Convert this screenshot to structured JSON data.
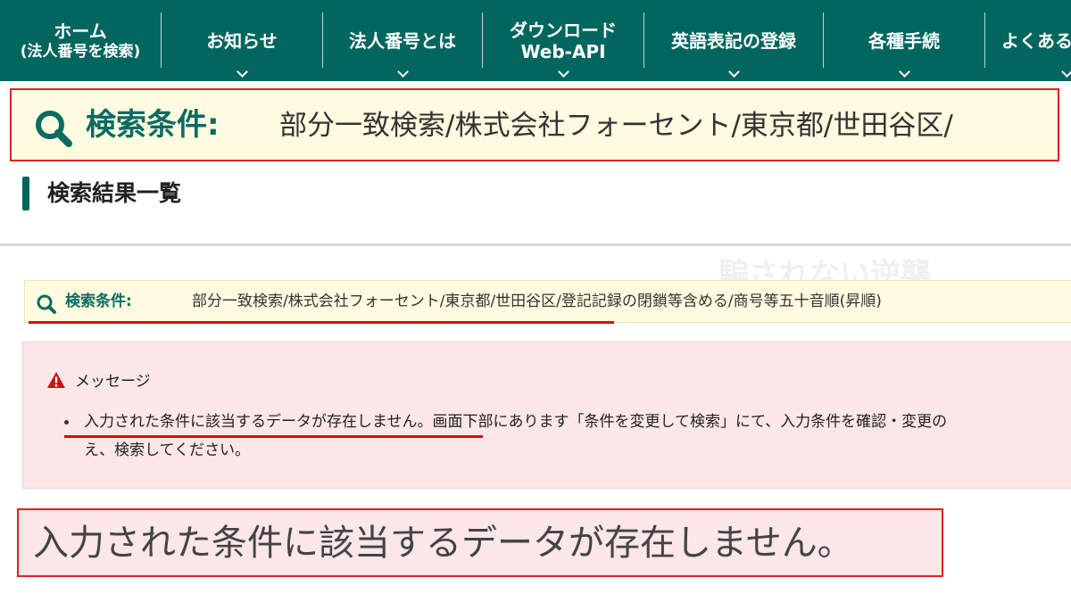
{
  "nav": {
    "items": [
      {
        "line1": "ホーム",
        "line2": "(法人番号を検索)",
        "has_dropdown": false
      },
      {
        "line1": "お知らせ",
        "line2": "",
        "has_dropdown": true
      },
      {
        "line1": "法人番号とは",
        "line2": "",
        "has_dropdown": true
      },
      {
        "line1": "ダウンロード",
        "line2": "Web-API",
        "has_dropdown": true
      },
      {
        "line1": "英語表記の登録",
        "line2": "",
        "has_dropdown": true
      },
      {
        "line1": "各種手続",
        "line2": "",
        "has_dropdown": true
      },
      {
        "line1": "よくある",
        "line2": "",
        "has_dropdown": true
      }
    ]
  },
  "zoom_condition": {
    "label": "検索条件:",
    "value": "部分一致検索/株式会社フォーセント/東京都/世田谷区/"
  },
  "results": {
    "title": "検索結果一覧"
  },
  "search_condition": {
    "label": "検索条件:",
    "value": "部分一致検索/株式会社フォーセント/東京都/世田谷区/登記記録の閉鎖等含める/商号等五十音順(昇順)"
  },
  "watermark": {
    "text": "騙されない逆襲"
  },
  "message": {
    "title": "メッセージ",
    "line1_highlight": "入力された条件に該当するデータが存在しません。",
    "line1_rest": "画面下部にあります「条件を変更して検索」にて、入力条件を確認・変更の",
    "line2": "え、検索してください。"
  },
  "zoom_message": {
    "text": "入力された条件に該当するデータが存在しません。"
  },
  "colors": {
    "nav_bg": "#00665e",
    "accent_teal": "#0d6b62",
    "condition_bg": "#fffbe0",
    "message_bg": "#fbe6e8",
    "highlight_red": "#e02020",
    "warning_red": "#c81414"
  }
}
